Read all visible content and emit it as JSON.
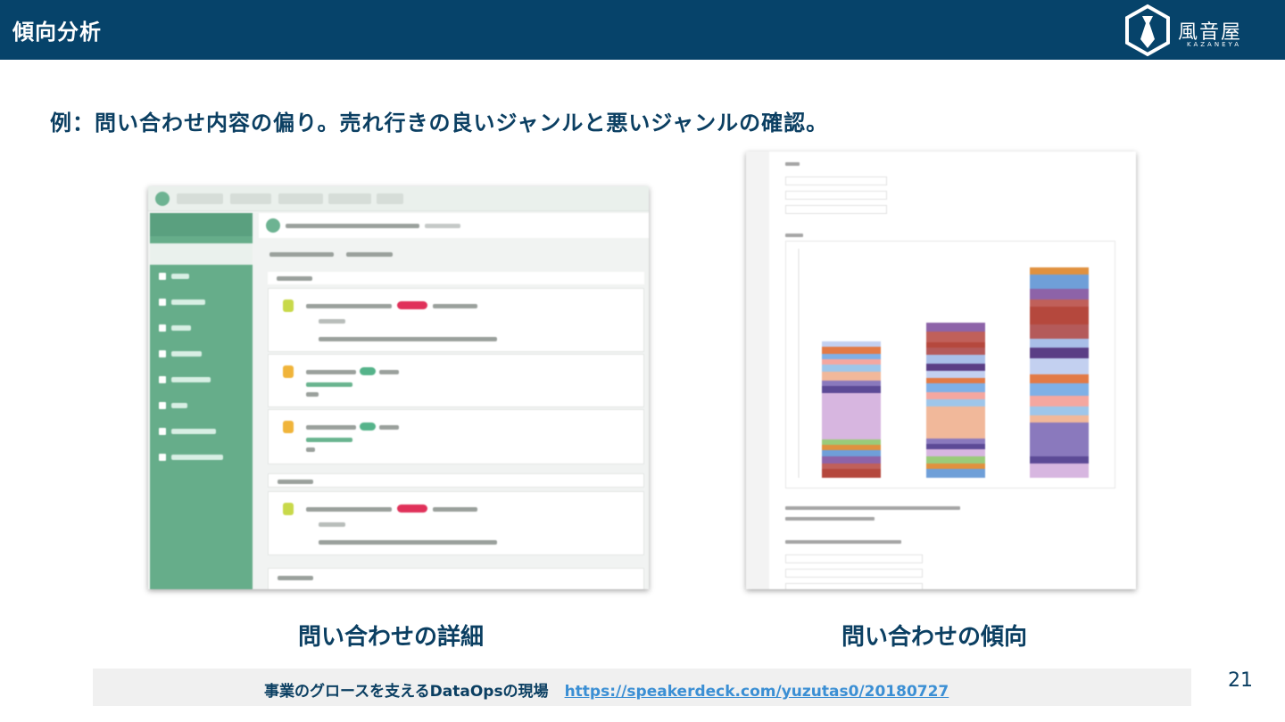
{
  "header": {
    "title": "傾向分析",
    "logo_text": "風音屋",
    "logo_sub": "KAZANEYA"
  },
  "slide": {
    "subtitle": "例：問い合わせ内容の偏り。売れ行きの良いジャンルと悪いジャンルの確認。",
    "caption_left": "問い合わせの詳細",
    "caption_right": "問い合わせの傾向",
    "page_number": "21"
  },
  "footer": {
    "text": "事業のグロースを支えるDataOpsの現場",
    "link": "https://speakerdeck.com/yuzutas0/20180727"
  },
  "colors": {
    "header_bg": "#06436a",
    "accent_text": "#0b3f62",
    "link": "#3b8fd4",
    "sidebar_green": "#66ad8a"
  }
}
